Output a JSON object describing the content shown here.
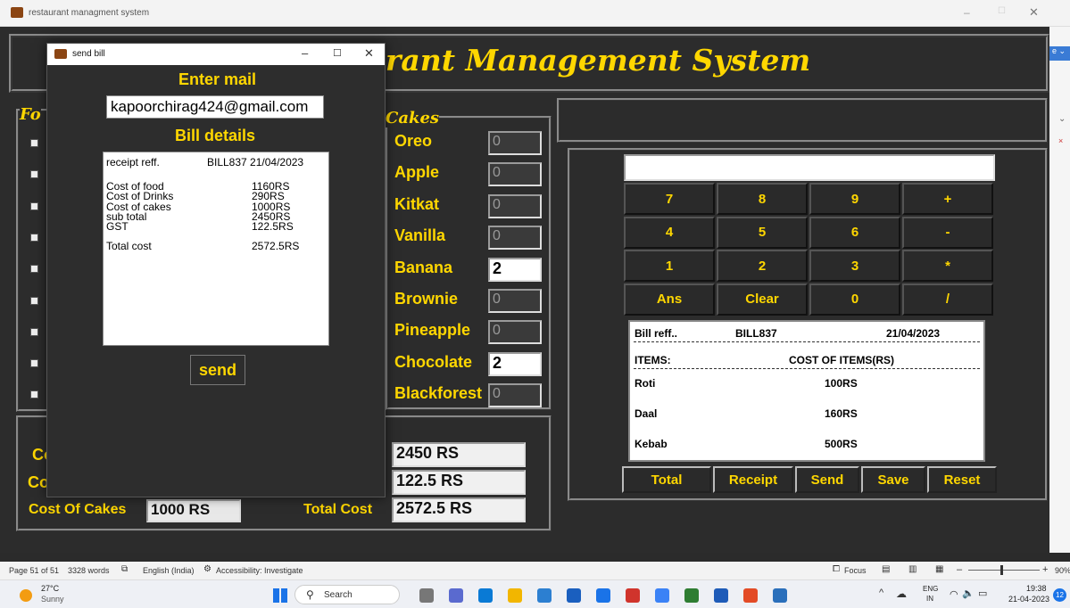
{
  "main_window": {
    "title": "restaurant managment system",
    "heading": "rant Management System",
    "food_frame_label": "Fo",
    "cakes_frame_label": "Cakes",
    "cakes": [
      {
        "label": "Oreo",
        "value": "0"
      },
      {
        "label": "Apple",
        "value": "0"
      },
      {
        "label": "Kitkat",
        "value": "0"
      },
      {
        "label": "Vanilla",
        "value": "0"
      },
      {
        "label": "Banana",
        "value": "2"
      },
      {
        "label": "Brownie",
        "value": "0"
      },
      {
        "label": "Pineapple",
        "value": "0"
      },
      {
        "label": "Chocolate",
        "value": "2"
      },
      {
        "label": "Blackforest",
        "value": "0"
      }
    ],
    "costs": {
      "cost_food_label_partial": "Co",
      "cost_drinks_label_partial": "Co",
      "cost_cakes_label": "Cost Of Cakes",
      "cost_cakes_value": "1000 RS",
      "total_cost_label": "Total Cost",
      "subtotal_value": "2450 RS",
      "gst_value": "122.5 RS",
      "total_cost_value": "2572.5 RS"
    },
    "calculator": {
      "display": "",
      "keys": [
        "7",
        "8",
        "9",
        "+",
        "4",
        "5",
        "6",
        "-",
        "1",
        "2",
        "3",
        "*",
        "Ans",
        "Clear",
        "0",
        "/"
      ]
    },
    "receipt": {
      "bill_ref_label": "Bill reff..",
      "bill_ref": "BILL837",
      "date": "21/04/2023",
      "items_label": "ITEMS:",
      "cost_label": "COST OF ITEMS(RS)",
      "items": [
        {
          "name": "Roti",
          "cost": "100RS"
        },
        {
          "name": "Daal",
          "cost": "160RS"
        },
        {
          "name": "Kebab",
          "cost": "500RS"
        }
      ]
    },
    "bottom_buttons": [
      "Total",
      "Receipt",
      "Send",
      "Save",
      "Reset"
    ]
  },
  "dialog": {
    "title": "send bill",
    "enter_mail_label": "Enter mail",
    "email_value": "kapoorchirag424@gmail.com",
    "bill_details_label": "Bill details",
    "bill_lines": [
      {
        "label": "receipt reff.",
        "value": "BILL837  21/04/2023"
      },
      {
        "label": "",
        "value": ""
      },
      {
        "label": "Cost of food",
        "value": "1160RS"
      },
      {
        "label": "Cost of Drinks",
        "value": "290RS"
      },
      {
        "label": "Cost of cakes",
        "value": "1000RS"
      },
      {
        "label": "sub total",
        "value": "2450RS"
      },
      {
        "label": "GST",
        "value": "122.5RS"
      },
      {
        "label": "",
        "value": ""
      },
      {
        "label": "Total cost",
        "value": "2572.5RS"
      }
    ],
    "send_label": "send"
  },
  "status_bar": {
    "page": "Page 51 of 51",
    "words": "3328 words",
    "language": "English (India)",
    "accessibility": "Accessibility: Investigate",
    "focus": "Focus",
    "zoom": "90%"
  },
  "taskbar": {
    "weather_temp": "27°C",
    "weather_desc": "Sunny",
    "search_placeholder": "Search",
    "lang_top": "ENG",
    "lang_bottom": "IN",
    "time": "19:38",
    "date": "21-04-2023",
    "notif_count": "12"
  }
}
